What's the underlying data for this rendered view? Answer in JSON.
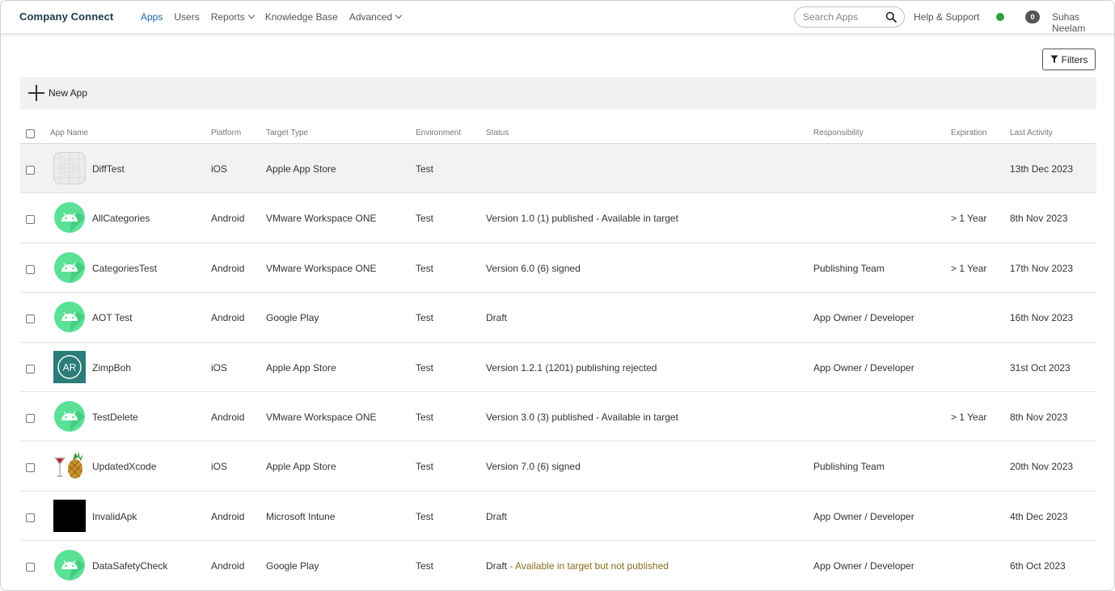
{
  "header": {
    "brand": "Company Connect",
    "nav": [
      {
        "label": "Apps",
        "active": true,
        "dropdown": false
      },
      {
        "label": "Users",
        "active": false,
        "dropdown": false
      },
      {
        "label": "Reports",
        "active": false,
        "dropdown": true
      },
      {
        "label": "Knowledge Base",
        "active": false,
        "dropdown": false
      },
      {
        "label": "Advanced",
        "active": false,
        "dropdown": true
      }
    ],
    "search_placeholder": "Search Apps",
    "help_label": "Help & Support",
    "status_color": "#2e9e3e",
    "notification_count": "0",
    "user_name": "Suhas Neelam"
  },
  "toolbar": {
    "filters_label": "Filters",
    "new_app_label": "New App"
  },
  "table": {
    "columns": {
      "name": "App Name",
      "platform": "Platform",
      "target": "Target Type",
      "environment": "Environment",
      "status": "Status",
      "responsibility": "Responsibility",
      "expiration": "Expiration",
      "last_activity": "Last Activity"
    },
    "rows": [
      {
        "icon": "placeholder-app-icon",
        "name": "DiffTest",
        "platform": "iOS",
        "target": "Apple App Store",
        "environment": "Test",
        "status": "",
        "status_warning": "",
        "responsibility": "",
        "expiration": "",
        "last_activity": "13th Dec 2023"
      },
      {
        "icon": "android-icon",
        "name": "AllCategories",
        "platform": "Android",
        "target": "VMware Workspace ONE",
        "environment": "Test",
        "status": "Version 1.0 (1) published - Available in target",
        "status_warning": "",
        "responsibility": "",
        "expiration": "> 1 Year",
        "last_activity": "8th Nov 2023"
      },
      {
        "icon": "android-icon",
        "name": "CategoriesTest",
        "platform": "Android",
        "target": "VMware Workspace ONE",
        "environment": "Test",
        "status": "Version 6.0 (6) signed",
        "status_warning": "",
        "responsibility": "Publishing Team",
        "expiration": "> 1 Year",
        "last_activity": "17th Nov 2023"
      },
      {
        "icon": "android-icon",
        "name": "AOT Test",
        "platform": "Android",
        "target": "Google Play",
        "environment": "Test",
        "status": "Draft",
        "status_warning": "",
        "responsibility": "App Owner / Developer",
        "expiration": "",
        "last_activity": "16th Nov 2023"
      },
      {
        "icon": "ar-app-icon",
        "icon_text": "AR",
        "name": "ZimpBoh",
        "platform": "iOS",
        "target": "Apple App Store",
        "environment": "Test",
        "status": "Version 1.2.1 (1201) publishing rejected",
        "status_warning": "",
        "responsibility": "App Owner / Developer",
        "expiration": "",
        "last_activity": "31st Oct 2023"
      },
      {
        "icon": "android-icon",
        "name": "TestDelete",
        "platform": "Android",
        "target": "VMware Workspace ONE",
        "environment": "Test",
        "status": "Version 3.0 (3) published - Available in target",
        "status_warning": "",
        "responsibility": "",
        "expiration": "> 1 Year",
        "last_activity": "8th Nov 2023"
      },
      {
        "icon": "pineapple-cocktail-icon",
        "name": "UpdatedXcode",
        "platform": "iOS",
        "target": "Apple App Store",
        "environment": "Test",
        "status": "Version 7.0 (6) signed",
        "status_warning": "",
        "responsibility": "Publishing Team",
        "expiration": "",
        "last_activity": "20th Nov 2023"
      },
      {
        "icon": "black-square-icon",
        "name": "InvalidApk",
        "platform": "Android",
        "target": "Microsoft Intune",
        "environment": "Test",
        "status": "Draft",
        "status_warning": "",
        "responsibility": "App Owner / Developer",
        "expiration": "",
        "last_activity": "4th Dec 2023"
      },
      {
        "icon": "android-icon",
        "name": "DataSafetyCheck",
        "platform": "Android",
        "target": "Google Play",
        "environment": "Test",
        "status": "Draft",
        "status_warning": " - Available in target but not published",
        "responsibility": "App Owner / Developer",
        "expiration": "",
        "last_activity": "6th Oct 2023"
      }
    ]
  }
}
